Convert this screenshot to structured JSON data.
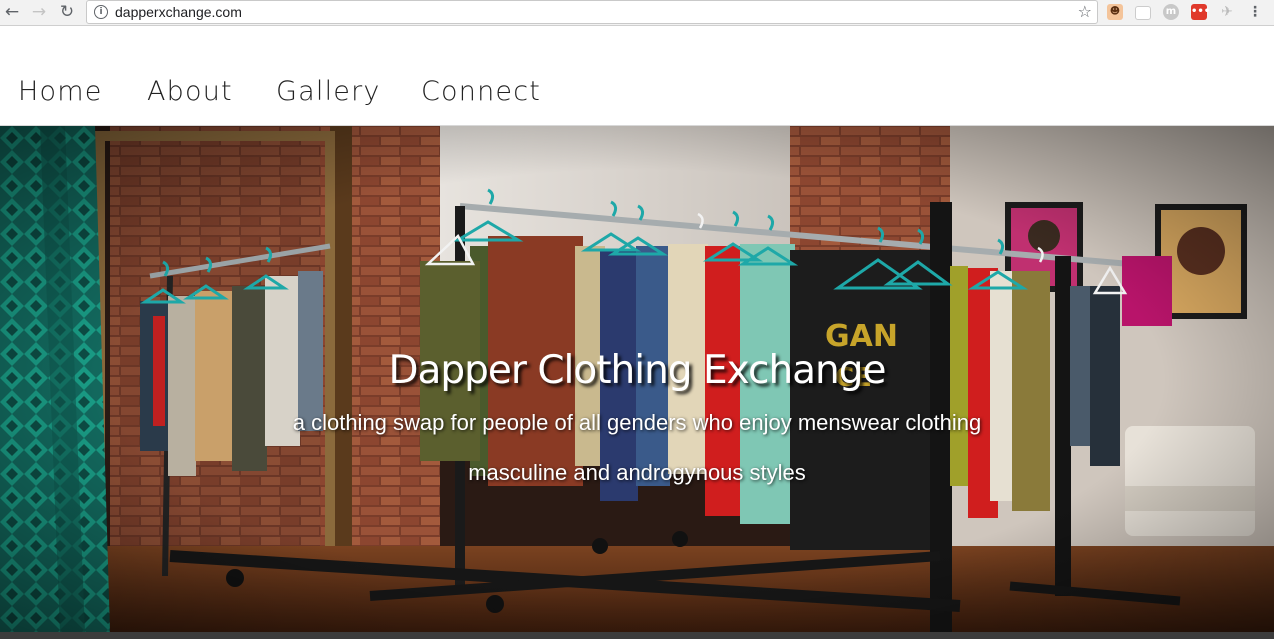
{
  "browser": {
    "url": "dapperxchange.com",
    "back_icon": "arrow-left",
    "forward_icon": "arrow-right",
    "reload_icon": "reload",
    "star_icon": "star-outline",
    "menu_icon": "vertical-dots"
  },
  "nav": {
    "items": [
      {
        "label": "Home"
      },
      {
        "label": "About"
      },
      {
        "label": "Gallery"
      },
      {
        "label": "Connect"
      }
    ]
  },
  "hero": {
    "title": "Dapper Clothing Exchange",
    "subtitle_line1": "a clothing swap for people of all genders who enjoy menswear clothing",
    "subtitle_line2": "masculine and androgynous styles",
    "image_subject": "clothing racks with shirts on hangers in a brick-walled room"
  },
  "colors": {
    "hanger_teal": "#1ea8a8",
    "brick": "#8a4a33",
    "floor": "#6b3a1e"
  }
}
